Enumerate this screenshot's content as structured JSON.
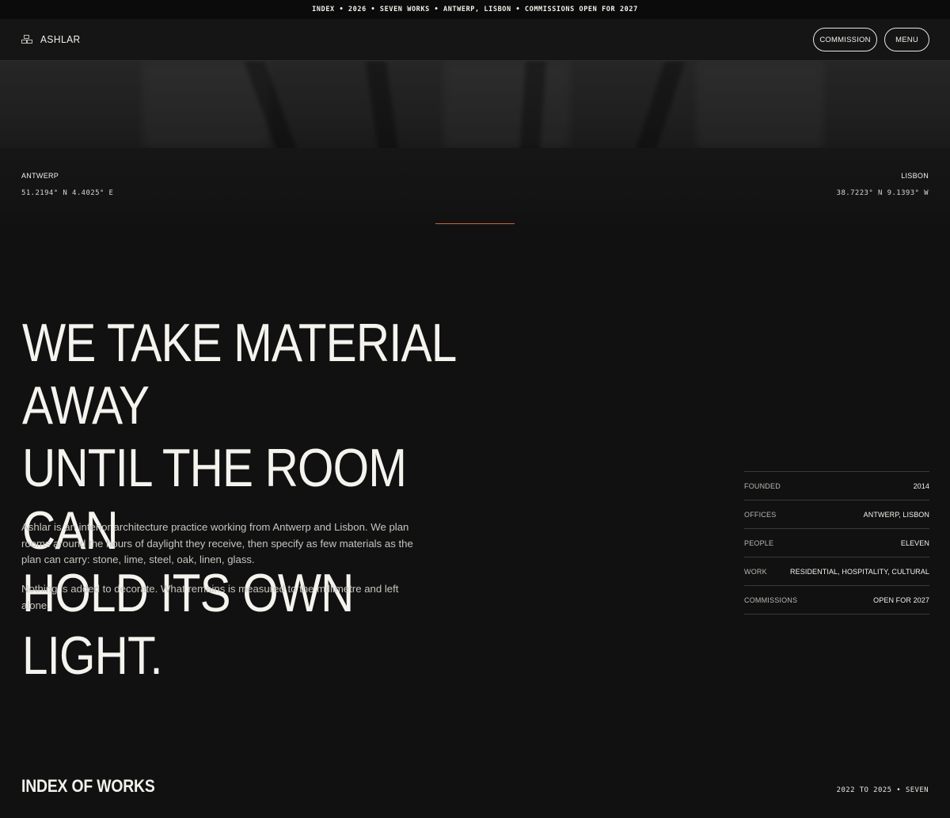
{
  "ticker": {
    "text": "INDEX • 2026 • SEVEN WORKS • ANTWERP, LISBON • COMMISSIONS OPEN FOR 2027"
  },
  "header": {
    "brand": "ASHLAR",
    "brand_icon": "bricks-icon",
    "commission_label": "COMMISSION",
    "menu_label": "MENU"
  },
  "hero": {
    "left": {
      "city": "ANTWERP",
      "coords": "51.2194° N 4.4025° E"
    },
    "right": {
      "city": "LISBON",
      "coords": "38.7223° N 9.1393° W"
    },
    "accent_color": "#c9683a"
  },
  "statement": {
    "line1": "WE TAKE MATERIAL AWAY",
    "line2": "UNTIL THE ROOM CAN",
    "line3": "HOLD ITS OWN LIGHT."
  },
  "about": {
    "p1": "Ashlar is an interior architecture practice working from Antwerp and Lisbon. We plan rooms around the hours of daylight they receive, then specify as few materials as the plan can carry: stone, lime, steel, oak, linen, glass.",
    "p2": "Nothing is added to decorate. What remains is measured to the millimetre and left alone."
  },
  "facts": [
    {
      "key": "FOUNDED",
      "value": "2014"
    },
    {
      "key": "OFFICES",
      "value": "ANTWERP, LISBON"
    },
    {
      "key": "PEOPLE",
      "value": "ELEVEN"
    },
    {
      "key": "WORK",
      "value": "RESIDENTIAL, HOSPITALITY, CULTURAL"
    },
    {
      "key": "COMMISSIONS",
      "value": "OPEN FOR 2027"
    }
  ],
  "index": {
    "title": "INDEX OF WORKS",
    "meta": "2022 TO 2025 • SEVEN"
  }
}
